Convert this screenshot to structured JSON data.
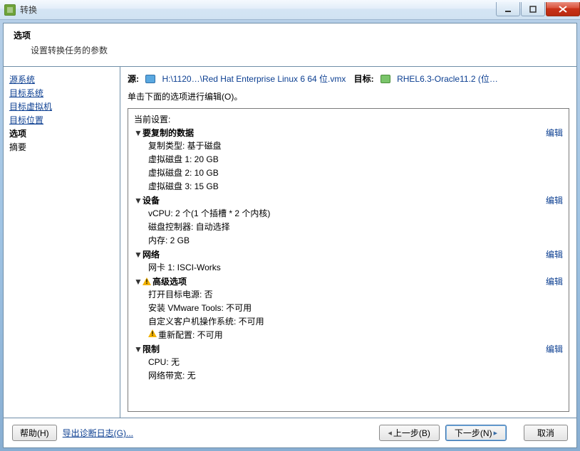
{
  "window": {
    "title": "转换"
  },
  "header": {
    "title": "选项",
    "subtitle": "设置转换任务的参数"
  },
  "sidebar": {
    "items": [
      {
        "key": "source",
        "label": "源系统",
        "link": true
      },
      {
        "key": "target",
        "label": "目标系统",
        "link": true
      },
      {
        "key": "targetvm",
        "label": "目标虚拟机",
        "link": true
      },
      {
        "key": "targetloc",
        "label": "目标位置",
        "link": true
      },
      {
        "key": "options",
        "label": "选项",
        "active": true
      },
      {
        "key": "summary",
        "label": "摘要",
        "plain": true
      }
    ]
  },
  "main": {
    "sourceLabel": "源:",
    "sourcePath": "H:\\1120…\\Red Hat Enterprise Linux 6 64 位.vmx",
    "targetLabel": "目标:",
    "targetValue": "RHEL6.3-Oracle11.2 (位…",
    "instruction": "单击下面的选项进行编辑(O)。",
    "currentSettings": "当前设置:",
    "editLabel": "编辑",
    "sections": [
      {
        "title": "要复制的数据",
        "warn": false,
        "editable": true,
        "rows": [
          "复制类型: 基于磁盘",
          "虚拟磁盘 1: 20 GB",
          "虚拟磁盘 2: 10 GB",
          "虚拟磁盘 3: 15 GB"
        ]
      },
      {
        "title": "设备",
        "warn": false,
        "editable": true,
        "rows": [
          "vCPU: 2 个(1 个插槽 * 2 个内核)",
          "磁盘控制器: 自动选择",
          "内存: 2 GB"
        ]
      },
      {
        "title": "网络",
        "warn": false,
        "editable": true,
        "rows": [
          "网卡 1: ISCI-Works"
        ]
      },
      {
        "title": "高级选项",
        "warn": true,
        "editable": true,
        "rows": [
          "打开目标电源: 否",
          "安装 VMware Tools: 不可用",
          "自定义客户机操作系统: 不可用",
          "⚠重新配置: 不可用"
        ]
      },
      {
        "title": "限制",
        "warn": false,
        "editable": true,
        "rows": [
          "CPU: 无",
          "网络带宽: 无"
        ]
      }
    ]
  },
  "footer": {
    "help": "帮助(H)",
    "exportLog": "导出诊断日志(G)...",
    "back": "上一步(B)",
    "next": "下一步(N)",
    "cancel": "取消"
  }
}
